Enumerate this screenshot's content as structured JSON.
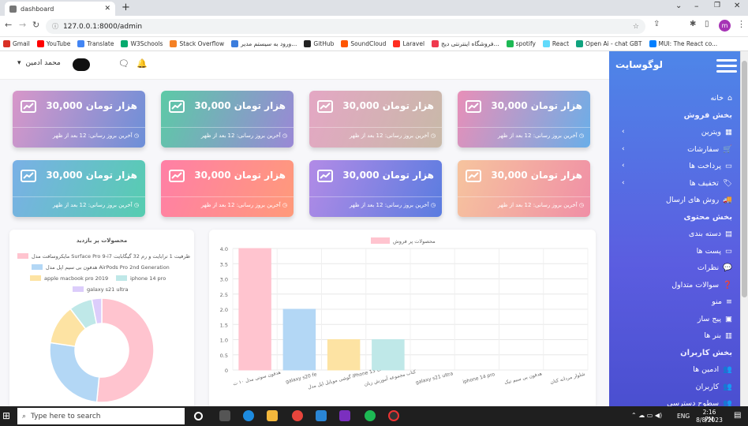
{
  "browser": {
    "tab_title": "dashboard",
    "url": "127.0.0.1:8000/admin",
    "profile_initial": "m",
    "bookmarks": [
      {
        "label": "Gmail",
        "color": "#d93025"
      },
      {
        "label": "YouTube",
        "color": "#ff0000"
      },
      {
        "label": "Translate",
        "color": "#4285f4"
      },
      {
        "label": "W3Schools",
        "color": "#04aa6d"
      },
      {
        "label": "Stack Overflow",
        "color": "#f48024"
      },
      {
        "label": "ورود به سیستم مدیر...",
        "color": "#3b7ddd"
      },
      {
        "label": "GitHub",
        "color": "#222222"
      },
      {
        "label": "SoundCloud",
        "color": "#ff5500"
      },
      {
        "label": "Laravel",
        "color": "#ff2d20"
      },
      {
        "label": "فروشگاه اینترنتی دیج...",
        "color": "#ef394e"
      },
      {
        "label": "spotify",
        "color": "#1db954"
      },
      {
        "label": "React",
        "color": "#61dafb"
      },
      {
        "label": "Open Ai - chat GBT",
        "color": "#10a37f"
      },
      {
        "label": "MUI: The React co...",
        "color": "#007fff"
      }
    ]
  },
  "topnav": {
    "user_name": "محمد ادمین"
  },
  "brand": {
    "logo": "لوگوسایت"
  },
  "cards": [
    {
      "value": "30,000 هزار تومان",
      "footer": "آخرین بروز رسانی: 12 بعد از ظهر",
      "c1": "#6aaee8",
      "c2": "#e88fb8"
    },
    {
      "value": "30,000 هزار تومان",
      "footer": "آخرین بروز رسانی: 12 بعد از ظهر",
      "c1": "#c8b9a8",
      "c2": "#e4a7c4"
    },
    {
      "value": "30,000 هزار تومان",
      "footer": "آخرین بروز رسانی: 12 بعد از ظهر",
      "c1": "#9a88d6",
      "c2": "#5ccaa6"
    },
    {
      "value": "30,000 هزار تومان",
      "footer": "آخرین بروز رسانی: 12 بعد از ظهر",
      "c1": "#6c8fd8",
      "c2": "#d897c9"
    },
    {
      "value": "30,000 هزار تومان",
      "footer": "آخرین بروز رسانی: 12 بعد از ظهر",
      "c1": "#f08fa6",
      "c2": "#f6c49e"
    },
    {
      "value": "30,000 هزار تومان",
      "footer": "آخرین بروز رسانی: 12 بعد از ظهر",
      "c1": "#5a7ce0",
      "c2": "#b28be6"
    },
    {
      "value": "30,000 هزار تومان",
      "footer": "آخرین بروز رسانی: 12 بعد از ظهر",
      "c1": "#ff9a7a",
      "c2": "#ff7fa6"
    },
    {
      "value": "30,000 هزار تومان",
      "footer": "آخرین بروز رسانی: 12 بعد از ظهر",
      "c1": "#56cdb0",
      "c2": "#7ab0e6"
    }
  ],
  "sidebar": {
    "home": "خانه",
    "section_sales": "بخش فروش",
    "sales_items": [
      "ویترین",
      "سفارشات",
      "پرداخت ها",
      "تخفیف ها",
      "روش های ارسال"
    ],
    "section_content": "بخش محتوی",
    "content_items": [
      "دسته بندی",
      "پست ها",
      "نظرات",
      "سوالات متداول",
      "منو",
      "پیج ساز",
      "بنر ها"
    ],
    "section_users": "بخش کاربران",
    "user_items": [
      "ادمین ها",
      "کاربران",
      "سطوح دسترسی"
    ]
  },
  "chart_data": [
    {
      "type": "pie",
      "title": "محصولات پر بازدید",
      "labels": [
        "مایکروسافت مدل Surface Pro 9-i7 ظرفیت 1 ترابایت و رم 32 گیگابایت",
        "هدفون بی سیم اپل مدل AirPods Pro 2nd Generation",
        "apple macbook pro 2019",
        "iphone 14 pro",
        "galaxy s21 ultra"
      ],
      "values": [
        50,
        25,
        12,
        7,
        3
      ],
      "colors": [
        "#ffc4cf",
        "#b3d7f5",
        "#fde3a3",
        "#bfe8e8",
        "#dccdfb"
      ]
    },
    {
      "type": "bar",
      "legend": "محصولات پر فروش",
      "categories": [
        "هدفون سونی مدل ۱۰ ت",
        "galaxy s20 fe",
        "گوشی موبایل اپل مدل iPhone 13 CH",
        "کتاب مجموعه آموزش زبان",
        "galaxy s21 ultra",
        "iphone 14 pro",
        "هدفون بی سیم تیک",
        "شلوار مردانه کتان"
      ],
      "values": [
        4,
        2,
        1,
        1,
        0,
        0,
        0,
        0
      ],
      "colors": [
        "#ffc4cf",
        "#b3d7f5",
        "#fde3a3",
        "#bfe8e8",
        "#dccdfb",
        "#ffc4cf",
        "#b3d7f5",
        "#fde3a3"
      ],
      "yticks": [
        "0",
        "0.5",
        "1.0",
        "1.5",
        "2.0",
        "2.5",
        "3.0",
        "3.5",
        "4.0"
      ],
      "ylim": [
        0,
        4
      ]
    }
  ],
  "taskbar": {
    "search_placeholder": "Type here to search",
    "time": "2:16 PM",
    "date": "8/8/2023",
    "lang": "ENG"
  }
}
